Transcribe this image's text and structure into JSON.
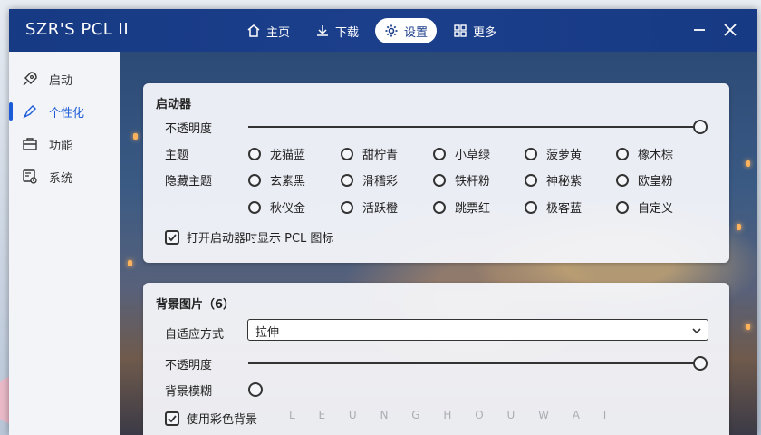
{
  "app": {
    "title": "SZR'S PCL II"
  },
  "nav": {
    "home": "主页",
    "download": "下载",
    "settings": "设置",
    "more": "更多"
  },
  "sidebar": {
    "items": [
      {
        "label": "启动",
        "icon": "rocket-icon"
      },
      {
        "label": "个性化",
        "icon": "brush-icon",
        "active": true
      },
      {
        "label": "功能",
        "icon": "toolbox-icon"
      },
      {
        "label": "系统",
        "icon": "system-settings-icon"
      }
    ]
  },
  "launcher": {
    "title": "启动器",
    "opacity_label": "不透明度",
    "opacity_value": 1.0,
    "theme_label": "主题",
    "hidden_theme_label": "隐藏主题",
    "themes": [
      "龙猫蓝",
      "甜柠青",
      "小草绿",
      "菠萝黄",
      "橡木棕"
    ],
    "hidden_themes_row1": [
      "玄素黑",
      "滑稽彩",
      "铁杆粉",
      "神秘紫",
      "欧皇粉"
    ],
    "hidden_themes_row2": [
      "秋仪金",
      "活跃橙",
      "跳票红",
      "极客蓝",
      "自定义"
    ],
    "show_icon_label": "打开启动器时显示 PCL 图标",
    "show_icon_checked": true
  },
  "background": {
    "title": "背景图片（6）",
    "fit_label": "自适应方式",
    "fit_value": "拉伸",
    "opacity_label": "不透明度",
    "opacity_value": 1.0,
    "blur_label": "背景模糊",
    "blur_value": 0,
    "color_bg_label": "使用彩色背景",
    "color_bg_checked": true
  },
  "watermark": "L E U N G H O U W A I",
  "colors": {
    "titlebar": "#1c3f8c",
    "accent": "#1c5bd8",
    "card": "#f4f6fa"
  }
}
